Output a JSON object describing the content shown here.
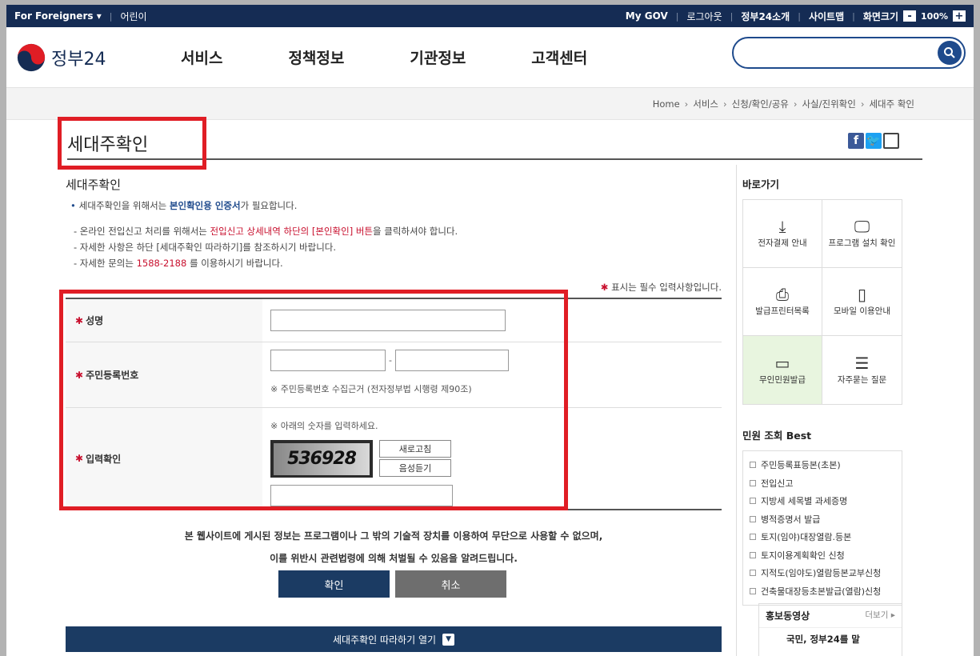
{
  "topbar": {
    "foreigners": "For Foreigners",
    "kids": "어린이",
    "mygov": "My GOV",
    "logout": "로그아웃",
    "about": "정부24소개",
    "sitemap": "사이트맵",
    "screen_size": "화면크기",
    "zoom_minus": "-",
    "zoom_value": "100%",
    "zoom_plus": "+"
  },
  "header": {
    "logo_text": "정부24",
    "nav": [
      "서비스",
      "정책정보",
      "기관정보",
      "고객센터"
    ],
    "search_placeholder": ""
  },
  "breadcrumb": [
    "Home",
    "서비스",
    "신청/확인/공유",
    "사실/진위확인",
    "세대주 확인"
  ],
  "page": {
    "title": "세대주확인",
    "sub_title": "세대주확인",
    "bullet_prefix": "세대주확인을 위해서는 ",
    "bullet_highlight": "본인확인용 인증서",
    "bullet_suffix": "가 필요합니다.",
    "note1_prefix": "- 온라인 전입신고 처리를 위해서는 ",
    "note1_highlight": "전입신고 상세내역 하단의 [본인확인] 버튼",
    "note1_suffix": "을 클릭하셔야 합니다.",
    "note2": "- 자세한 사항은 하단 [세대주확인 따라하기]를 참조하시기 바랍니다.",
    "note3_prefix": "- 자세한 문의는 ",
    "note3_phone": "1588-2188",
    "note3_suffix": " 를 이용하시기 바랍니다.",
    "required_note": "표시는 필수 입력사항입니다."
  },
  "form": {
    "name_label": "성명",
    "rrn_label": "주민등록번호",
    "rrn_note": "※ 주민등록번호 수집근거 (전자정부법 시행령 제90조)",
    "captcha_label": "입력확인",
    "captcha_note": "※ 아래의 숫자를 입력하세요.",
    "captcha_text": "536928",
    "refresh_label": "새로고침",
    "audio_label": "음성듣기"
  },
  "warning": {
    "line1": "본 웹사이트에 게시된 정보는 프로그램이나 그 밖의 기술적 장치를 이용하여 무단으로 사용할 수 없으며,",
    "line2": "이를 위반시 관련법령에 의해 처벌될 수 있음을 알려드립니다."
  },
  "buttons": {
    "ok": "확인",
    "cancel": "취소",
    "follow": "세대주확인 따라하기 열기"
  },
  "sidebar": {
    "quick_title": "바로가기",
    "quick_items": [
      {
        "label": "전자결제 안내",
        "icon": "download-icon"
      },
      {
        "label": "프로그램 설치 확인",
        "icon": "monitor-icon"
      },
      {
        "label": "발급프린터목록",
        "icon": "printer-icon"
      },
      {
        "label": "모바일 이용안내",
        "icon": "mobile-icon"
      },
      {
        "label": "무인민원발급",
        "icon": "kiosk-icon"
      },
      {
        "label": "자주묻는 질문",
        "icon": "chat-icon"
      }
    ],
    "best_title": "민원 조회 Best",
    "best_items": [
      "주민등록표등본(초본)",
      "전입신고",
      "지방세 세목별 과세증명",
      "병적증명서 발급",
      "토지(임야)대장열람.등본",
      "토지이용계획확인 신청",
      "지적도(임야도)열람등본교부신청",
      "건축물대장등초본발급(열람)신청"
    ],
    "promo_title": "홍보동영상",
    "promo_more": "더보기",
    "promo_text": "국민, 정부24를 말"
  },
  "colors": {
    "navy": "#152c54",
    "accent_blue": "#1e4a8c",
    "highlight_red": "#e01d25",
    "button_dark": "#1b3b63"
  }
}
